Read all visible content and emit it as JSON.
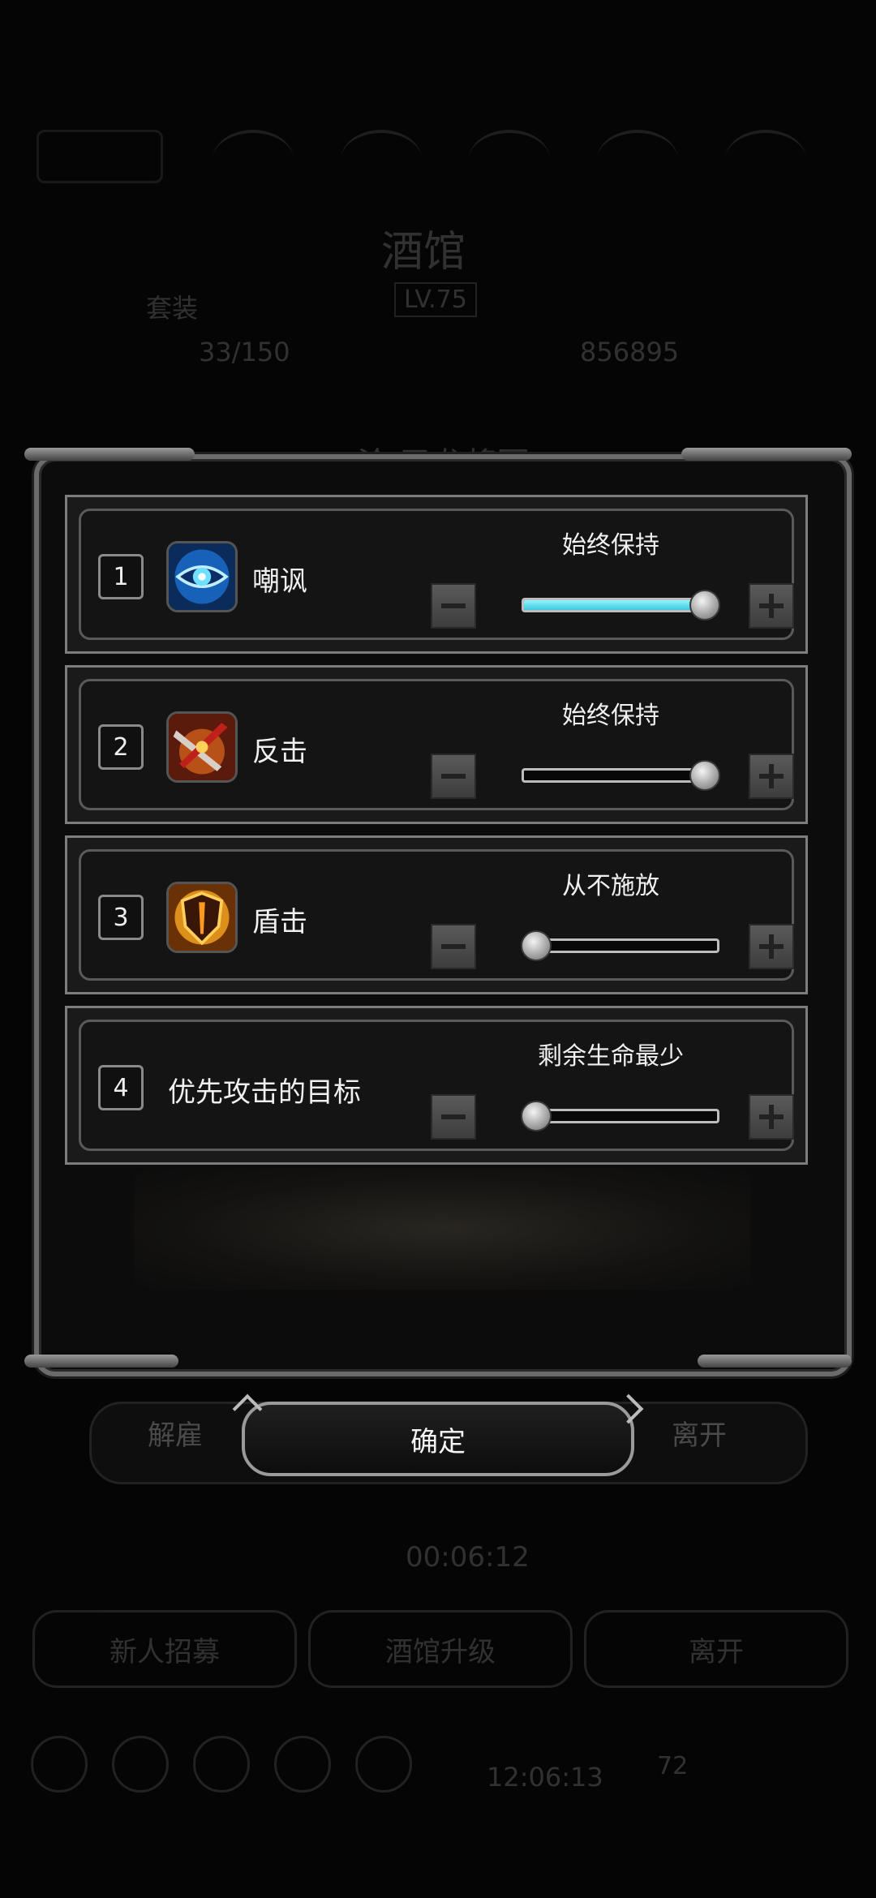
{
  "background": {
    "hero_name": "酒馆",
    "hero_level": "LV.75",
    "suit_label": "套装",
    "stat_left": "33/150",
    "stat_right": "856895",
    "banner": "沦 圣龙将军",
    "dismiss_label": "解雇",
    "leave_label": "离开",
    "timer": "00:06:12",
    "recruit_label": "新人招募",
    "upgrade_label": "酒馆升级",
    "leave_label_2": "离开",
    "clock": "12:06:13",
    "battery": "72"
  },
  "settings": [
    {
      "index": "1",
      "name": "嘲讽",
      "icon": "taunt-eye-icon",
      "status": "始终保持",
      "level": 1.0,
      "filled": true
    },
    {
      "index": "2",
      "name": "反击",
      "icon": "counter-blade-icon",
      "status": "始终保持",
      "level": 1.0,
      "filled": false
    },
    {
      "index": "3",
      "name": "盾击",
      "icon": "shield-bash-icon",
      "status": "从不施放",
      "level": 0.0,
      "filled": false
    },
    {
      "index": "4",
      "name": "优先攻击的目标",
      "icon": "",
      "status": "剩余生命最少",
      "level": 0.0,
      "filled": false
    }
  ],
  "confirm_label": "确定",
  "colors": {
    "slider_fill": "#3fc8e0",
    "panel_border": "#6b6b6b"
  }
}
